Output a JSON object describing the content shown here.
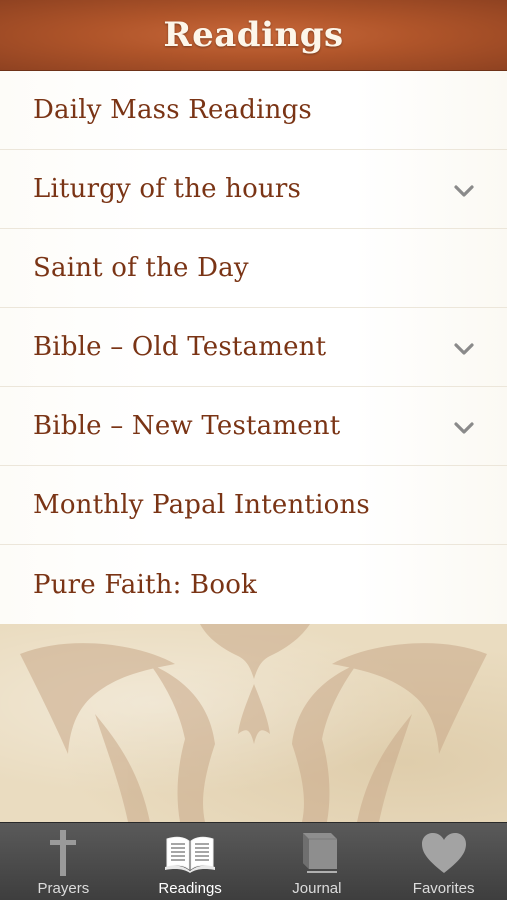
{
  "header": {
    "title": "Readings"
  },
  "list": {
    "items": [
      {
        "label": "Daily Mass Readings",
        "expandable": false
      },
      {
        "label": "Liturgy of the hours",
        "expandable": true
      },
      {
        "label": "Saint of the Day",
        "expandable": false
      },
      {
        "label": "Bible – Old Testament",
        "expandable": true
      },
      {
        "label": "Bible – New Testament",
        "expandable": true
      },
      {
        "label": "Monthly Papal Intentions",
        "expandable": false
      },
      {
        "label": "Pure Faith: Book",
        "expandable": false
      }
    ]
  },
  "tabbar": {
    "tabs": [
      {
        "label": "Prayers",
        "icon": "cross-icon",
        "active": false
      },
      {
        "label": "Readings",
        "icon": "open-book-icon",
        "active": true
      },
      {
        "label": "Journal",
        "icon": "closed-book-icon",
        "active": false
      },
      {
        "label": "Favorites",
        "icon": "heart-icon",
        "active": false
      }
    ]
  },
  "colors": {
    "header": "#b0552a",
    "row_text": "#7a3415",
    "tabbar": "#4a4a4a",
    "chevron": "#8a8a8a"
  }
}
